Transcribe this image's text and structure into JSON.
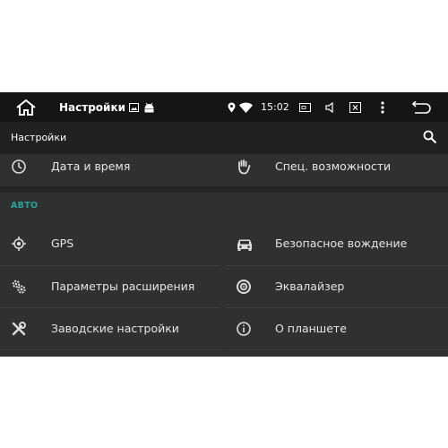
{
  "status_bar": {
    "title": "Настройки",
    "time": "15:02"
  },
  "toolbar": {
    "title": "Настройки"
  },
  "top_items": [
    {
      "label": "Дата и время",
      "icon": "clock-icon"
    },
    {
      "label": "Спец. возможности",
      "icon": "hand-icon"
    }
  ],
  "section": {
    "title": "АВТО",
    "items": [
      {
        "label": "GPS",
        "icon": "gps-icon"
      },
      {
        "label": "Безопасное вождение",
        "icon": "car-icon"
      },
      {
        "label": "Параметры расширения",
        "icon": "settings-icon"
      },
      {
        "label": "Эквалайзер",
        "icon": "equalizer-icon"
      },
      {
        "label": "Заводские настройки",
        "icon": "tools-icon"
      },
      {
        "label": "О планшете",
        "icon": "info-icon"
      }
    ]
  },
  "colors": {
    "accent": "#26a69a",
    "background": "#303030",
    "status_bar": "#151515",
    "toolbar": "#212121"
  }
}
